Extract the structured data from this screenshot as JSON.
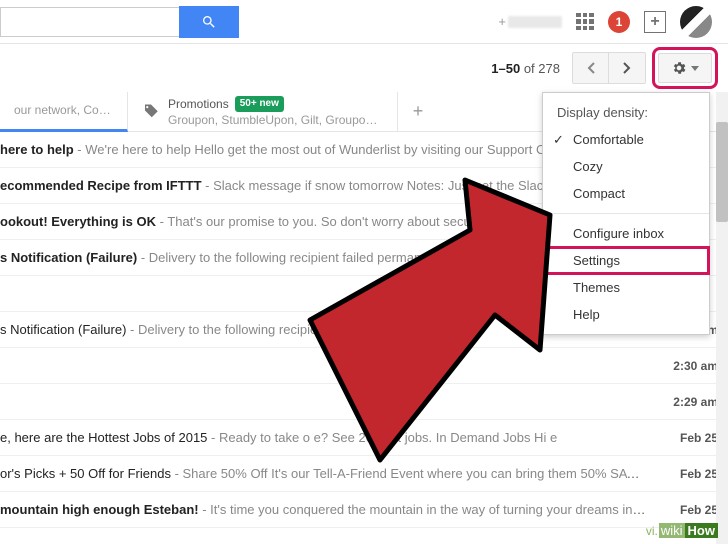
{
  "header": {
    "search_placeholder": "",
    "user_label": "+",
    "notifications": "1",
    "share_label": "+"
  },
  "pagination": {
    "range": "1–50",
    "of": "of",
    "total": "278"
  },
  "tabs": {
    "social": {
      "sub": "our network, Couchsurfin…"
    },
    "promotions": {
      "title": "Promotions",
      "badge": "50+ new",
      "sub": "Groupon, StumbleUpon, Gilt, Groupo…"
    },
    "add": "+"
  },
  "dropdown": {
    "heading": "Display density:",
    "comfortable": "Comfortable",
    "cozy": "Cozy",
    "compact": "Compact",
    "configure": "Configure inbox",
    "settings": "Settings",
    "themes": "Themes",
    "help": "Help"
  },
  "emails": [
    {
      "subject": "here to help",
      "snippet": " - We're here to help Hello            get the most out of Wunderlist by visiting our Support Ce",
      "bold": true,
      "time": ""
    },
    {
      "subject": "ecommended Recipe from IFTTT",
      "snippet": " - Slack message if snow tomorrow Notes: Just set the Slack channel an",
      "bold": true,
      "time": ""
    },
    {
      "subject": "ookout! Everything is OK",
      "snippet": " - That's our promise to you. So don't worry about security (that's our job) but",
      "bold": true,
      "time": ""
    },
    {
      "subject": "s Notification (Failure)",
      "snippet": " - Delivery to the following recipient failed permanently:           @gmail.",
      "bold": true,
      "time": ""
    },
    {
      "subject": "",
      "snippet": "",
      "bold": true,
      "time": ""
    },
    {
      "subject": "s Notification (Failure)",
      "snippet": " - Delivery to the following recipient fail                                        il.com Technical d",
      "bold": false,
      "time": "2:31 am"
    },
    {
      "subject": "",
      "snippet": "",
      "bold": false,
      "time": "2:30 am"
    },
    {
      "subject": "",
      "snippet": "",
      "bold": false,
      "time": "2:29 am"
    },
    {
      "subject": "e, here are the Hottest Jobs of 2015",
      "snippet": " - Ready to take o                e? See 2015          st jobs. In Demand Jobs Hi e",
      "bold": false,
      "time": "Feb 25"
    },
    {
      "subject": "or's Picks + 50 Off for Friends",
      "snippet": " - Share 50% Off It's our Tell-A-Friend Event where you can bring them 50% SAVIN",
      "bold": false,
      "time": "Feb 25"
    },
    {
      "subject": "mountain high enough Esteban!",
      "snippet": " - It's time you conquered the mountain in the way of turning your dreams into a",
      "bold": true,
      "time": "Feb 25"
    }
  ],
  "badge": {
    "vi": "vi.",
    "wiki": "wiki",
    "how": "How"
  }
}
